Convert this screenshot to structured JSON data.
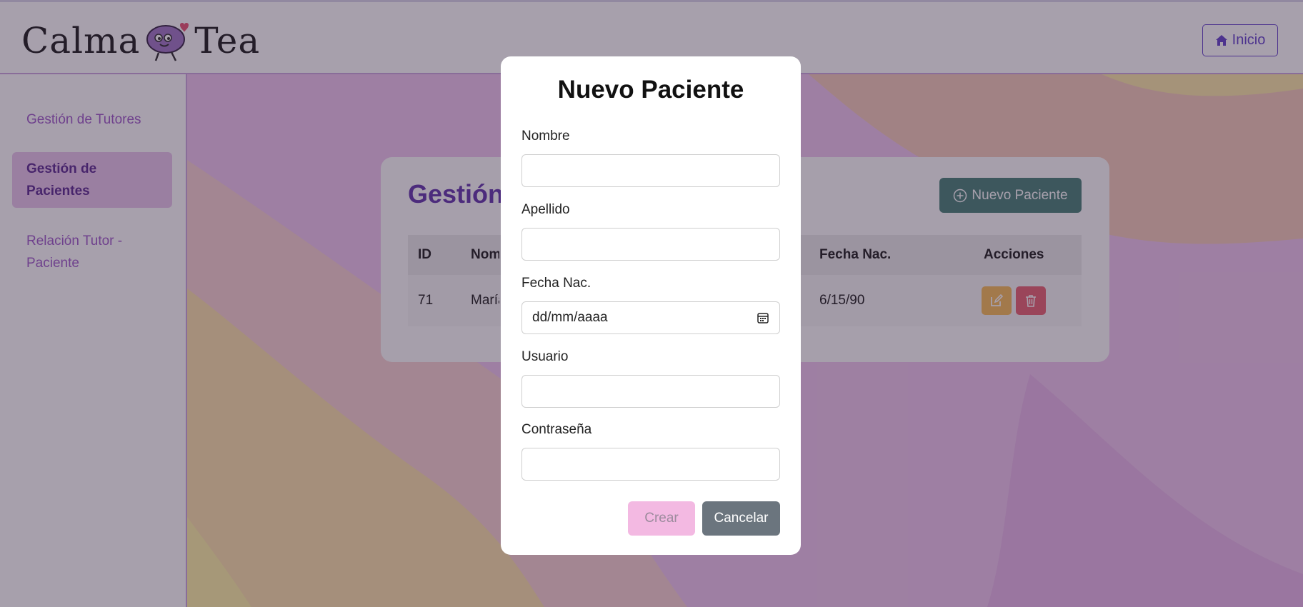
{
  "header": {
    "logo_left": "Calma",
    "logo_right": "Tea",
    "home_label": "Inicio"
  },
  "sidebar": {
    "items": [
      {
        "label": "Gestión de Tutores"
      },
      {
        "label": "Gestión de Pacientes"
      },
      {
        "label": "Relación Tutor - Paciente"
      }
    ]
  },
  "main": {
    "title": "Gestión de Pacientes",
    "new_button": "Nuevo Paciente",
    "table": {
      "headers": [
        "ID",
        "Nombre",
        "Fecha Nac.",
        "Acciones"
      ],
      "rows": [
        {
          "id": "71",
          "name": "María",
          "birth": "6/15/90"
        }
      ]
    }
  },
  "modal": {
    "title": "Nuevo Paciente",
    "fields": {
      "nombre_label": "Nombre",
      "apellido_label": "Apellido",
      "fecha_label": "Fecha Nac.",
      "fecha_placeholder": "dd/mm/aaaa",
      "usuario_label": "Usuario",
      "password_label": "Contraseña"
    },
    "create_label": "Crear",
    "cancel_label": "Cancelar"
  },
  "colors": {
    "accent_purple": "#5b3ac8",
    "sidebar_active_bg": "#e8c3ec",
    "primary_teal": "#3e7a70",
    "edit_orange": "#f6b84f",
    "delete_red": "#e85a6a"
  }
}
